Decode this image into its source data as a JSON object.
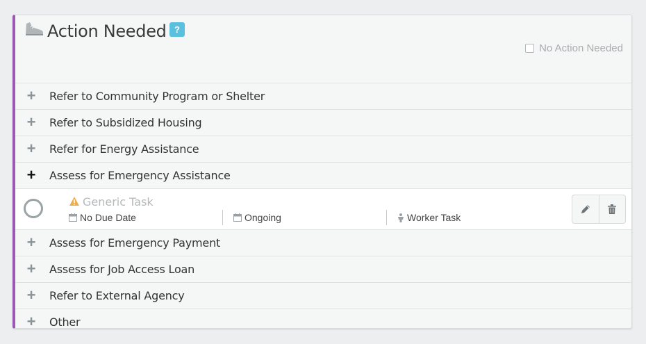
{
  "header": {
    "title": "Action Needed",
    "help_label": "?",
    "no_action_label": "No Action Needed"
  },
  "items_before": [
    {
      "label": "Refer to Community Program or Shelter",
      "icon": "plus-icon"
    },
    {
      "label": "Refer to Subsidized Housing",
      "icon": "plus-icon"
    },
    {
      "label": "Refer for Energy Assistance",
      "icon": "plus-icon"
    },
    {
      "label": "Assess for Emergency Assistance",
      "icon": "plus-icon",
      "expanded": true
    }
  ],
  "task": {
    "name": "Generic Task",
    "due": "No Due Date",
    "recurrence": "Ongoing",
    "type": "Worker Task"
  },
  "items_after": [
    {
      "label": "Assess for Emergency Payment",
      "icon": "plus-icon"
    },
    {
      "label": "Assess for Job Access Loan",
      "icon": "plus-icon"
    },
    {
      "label": "Refer to External Agency",
      "icon": "plus-icon"
    },
    {
      "label": "Other",
      "icon": "plus-icon"
    }
  ],
  "colors": {
    "accent": "#9b59b6",
    "help_badge": "#5bc0de",
    "warning": "#f0ad4e"
  }
}
